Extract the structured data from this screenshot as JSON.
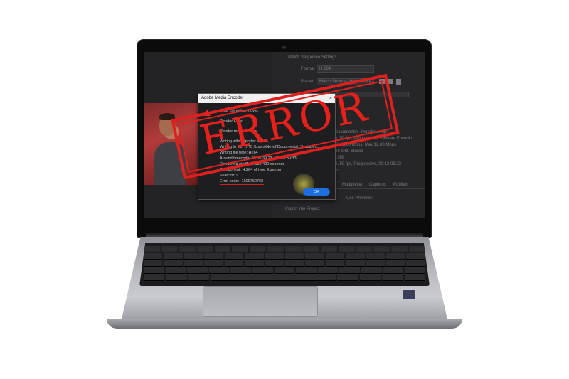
{
  "stamp": {
    "text": "ERROR"
  },
  "dialog": {
    "title": "Adobe Media Encoder",
    "close": "×",
    "lines": [
      "Error compiling movie.",
      "Render Error",
      "Render returned error.",
      "Writing with exporter: H.264",
      "Writing to file: \\\\?\\C:\\Users\\Neval\\Documents\\_Youtube\\...",
      "Writing file type: H264",
      "Around timecode: 00:05:39:23 - 00:05:39:33",
      "Rendering at offset: 339.420 seconds",
      "Component: H.264 of type Exporter",
      "Selector: 9",
      "Error code: -1609760768"
    ],
    "ok_label": "OK"
  },
  "export_panel": {
    "match_sequence": "Match Sequence Settings",
    "format_label": "Format:",
    "format_value": "H.264",
    "preset_label": "Preset:",
    "preset_value": "Match Source - High bitrate",
    "summary": [
      "Documents\\_Youtube\\1.mp4",
      "0, 50 fps, Progressive, Software Encodin...",
      "(0, 1000 Mbps, Max 12.00 Mbps",
      "48 kHz, Stereo",
      "1958",
      "0, 50 fps, Progressive, 00:13:05:23",
      "co"
    ],
    "tabs": [
      "Multiplexer",
      "Captions",
      "Publish"
    ],
    "use_previews": "Use Previews",
    "import_into_project": "Import into Project"
  }
}
